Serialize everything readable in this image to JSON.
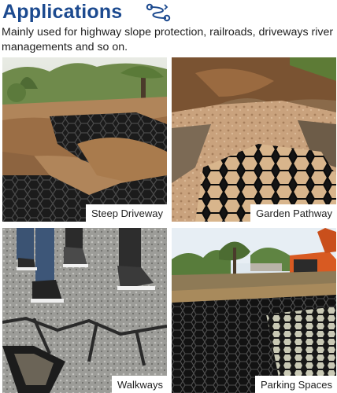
{
  "header": {
    "title": "Applications",
    "icon": "route-icon",
    "accent_color": "#1c4a8f"
  },
  "intro_text": "Mainly used for highway slope protection, railroads, driveways river managements and so on.",
  "tiles": [
    {
      "label": "Steep Driveway",
      "image": "steep-driveway-photo"
    },
    {
      "label": "Garden Pathway",
      "image": "garden-pathway-photo"
    },
    {
      "label": "Walkways",
      "image": "walkways-photo"
    },
    {
      "label": "Parking Spaces",
      "image": "parking-spaces-photo"
    }
  ]
}
